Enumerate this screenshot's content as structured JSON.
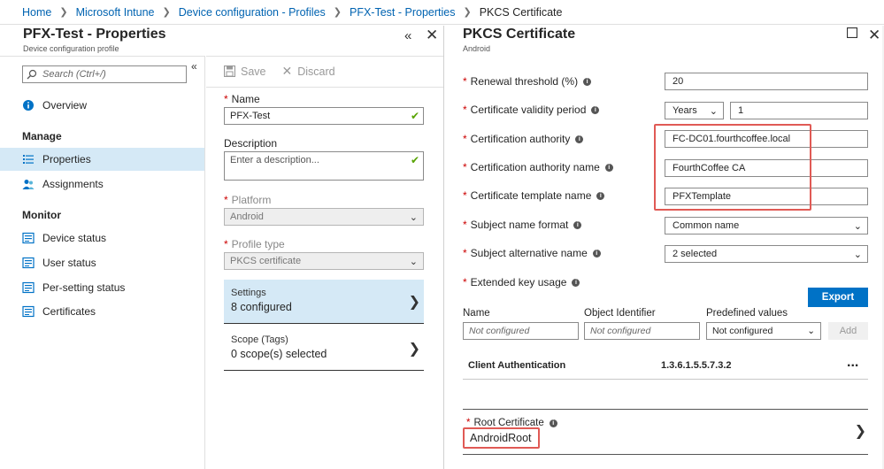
{
  "breadcrumb": {
    "items": [
      "Home",
      "Microsoft Intune",
      "Device configuration - Profiles",
      "PFX-Test - Properties"
    ],
    "current": "PKCS Certificate"
  },
  "blade1": {
    "title": "PFX-Test - Properties",
    "subtitle": "Device configuration profile",
    "search_placeholder": "Search (Ctrl+/)",
    "nav": {
      "overview": "Overview",
      "manage_header": "Manage",
      "properties": "Properties",
      "assignments": "Assignments",
      "monitor_header": "Monitor",
      "device_status": "Device status",
      "user_status": "User status",
      "per_setting_status": "Per-setting status",
      "certificates": "Certificates"
    },
    "toolbar": {
      "save": "Save",
      "discard": "Discard"
    },
    "form": {
      "name_label": "Name",
      "name_value": "PFX-Test",
      "description_label": "Description",
      "description_placeholder": "Enter a description...",
      "platform_label": "Platform",
      "platform_value": "Android",
      "profile_type_label": "Profile type",
      "profile_type_value": "PKCS certificate",
      "settings_label": "Settings",
      "settings_value": "8 configured",
      "scope_label": "Scope (Tags)",
      "scope_value": "0 scope(s) selected"
    }
  },
  "blade2": {
    "title": "PKCS Certificate",
    "subtitle": "Android",
    "fields": {
      "renewal_label": "Renewal threshold (%)",
      "renewal_value": "20",
      "validity_label": "Certificate validity period",
      "validity_unit": "Years",
      "validity_value": "1",
      "ca_label": "Certification authority",
      "ca_value": "FC-DC01.fourthcoffee.local",
      "ca_name_label": "Certification authority name",
      "ca_name_value": "FourthCoffee CA",
      "template_label": "Certificate template name",
      "template_value": "PFXTemplate",
      "subject_format_label": "Subject name format",
      "subject_format_value": "Common name",
      "san_label": "Subject alternative name",
      "san_value": "2 selected",
      "eku_label": "Extended key usage"
    },
    "export_label": "Export",
    "eku_columns": {
      "name": "Name",
      "oid": "Object Identifier",
      "predefined": "Predefined values"
    },
    "eku_inputs": {
      "name_ph": "Not configured",
      "oid_ph": "Not configured",
      "predefined_value": "Not configured",
      "add": "Add"
    },
    "eku_row": {
      "name": "Client Authentication",
      "oid": "1.3.6.1.5.5.7.3.2",
      "menu": "..."
    },
    "root_cert": {
      "label": "Root Certificate",
      "value": "AndroidRoot"
    }
  },
  "colors": {
    "accent": "#0072c6",
    "link": "#0063b1",
    "selected": "#d5e9f6",
    "highlight": "#e05a55",
    "required": "#cc0000",
    "valid": "#57a300"
  }
}
